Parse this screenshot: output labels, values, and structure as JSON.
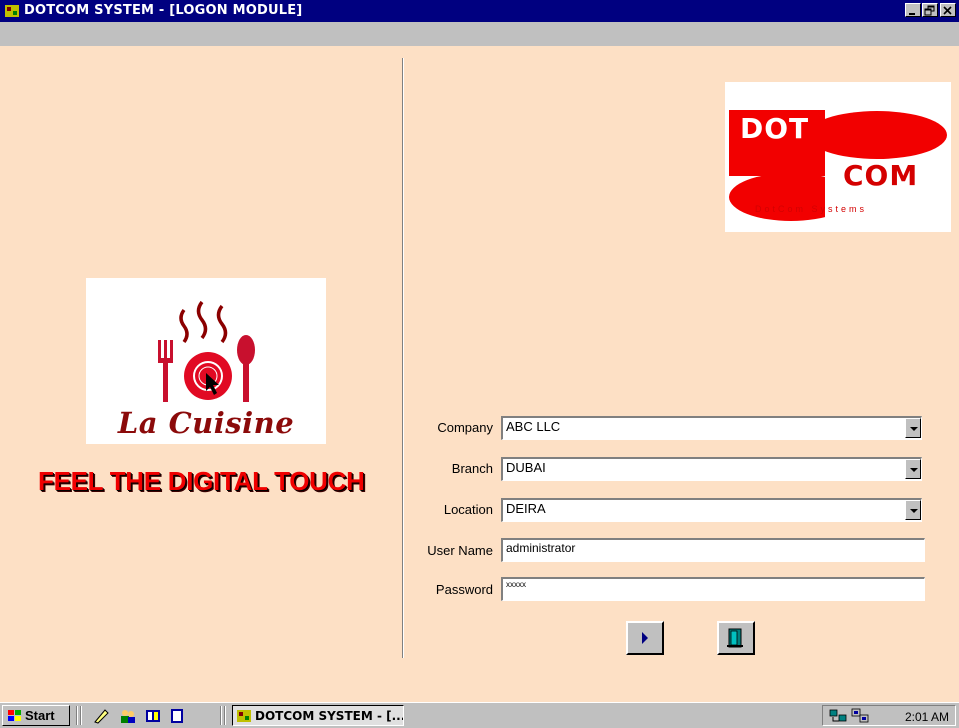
{
  "window": {
    "title": "DOTCOM SYSTEM - [LOGON MODULE]"
  },
  "branding": {
    "left_logo_text": "La Cuisine",
    "tagline": "FEEL THE DIGITAL TOUCH",
    "right_logo_line1": "DOT",
    "right_logo_line2": "COM",
    "right_logo_sub": "DotCom Systems"
  },
  "form": {
    "company_label": "Company",
    "company_value": "ABC LLC",
    "branch_label": "Branch",
    "branch_value": "DUBAI",
    "location_label": "Location",
    "location_value": "DEIRA",
    "username_label": "User Name",
    "username_value": "administrator",
    "password_label": "Password",
    "password_value": "xxxxx"
  },
  "taskbar": {
    "start_label": "Start",
    "task_label": "DOTCOM SYSTEM - [...",
    "clock": "2:01 AM"
  },
  "colors": {
    "title_bar": "#000080",
    "form_bg": "#fde0c5",
    "brand_red": "#f00000"
  }
}
